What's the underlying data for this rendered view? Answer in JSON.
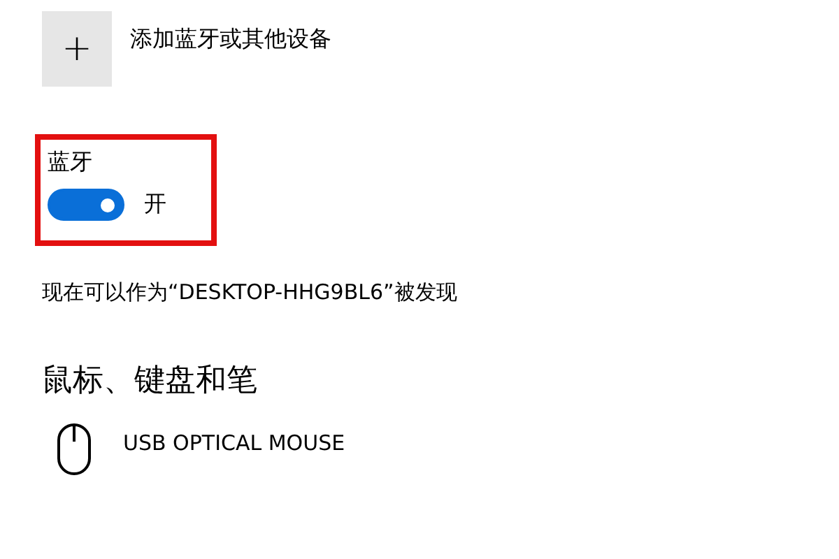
{
  "add_device": {
    "icon_text": "+",
    "label": "添加蓝牙或其他设备"
  },
  "bluetooth": {
    "title": "蓝牙",
    "on": true,
    "state_label": "开",
    "highlighted": true
  },
  "discoverable_text": "现在可以作为“DESKTOP-HHG9BL6”被发现",
  "section": {
    "title": "鼠标、键盘和笔",
    "devices": [
      {
        "kind": "mouse",
        "name": "USB OPTICAL MOUSE"
      }
    ]
  }
}
